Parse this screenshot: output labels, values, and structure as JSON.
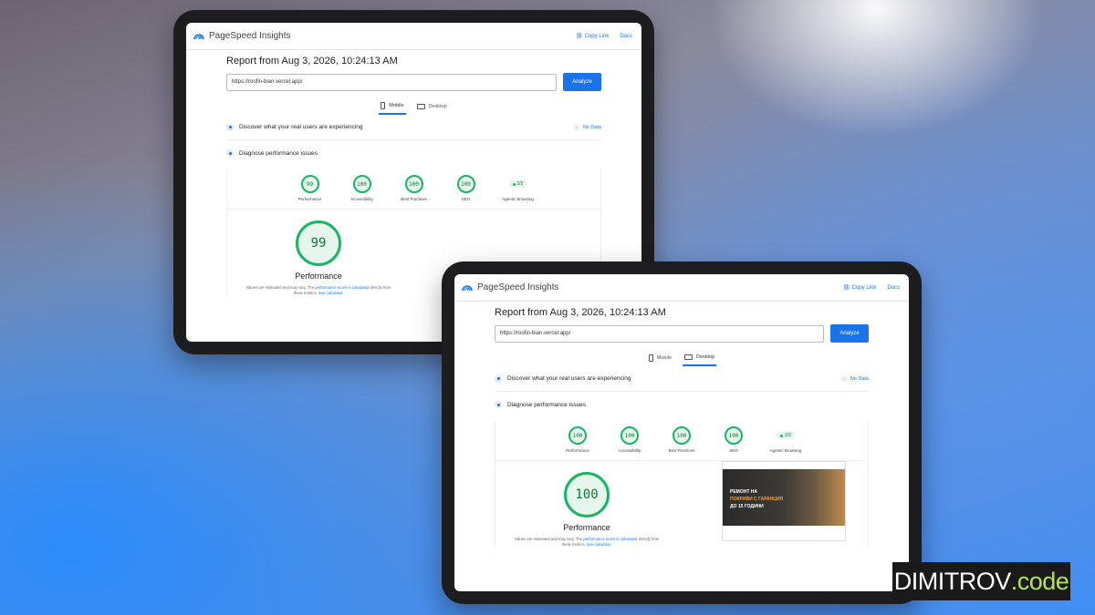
{
  "tablet_mobile": {
    "header": {
      "title": "PageSpeed Insights",
      "copy_link": "Copy Link",
      "docs": "Docs"
    },
    "report_title": "Report from Aug 3, 2026, 10:24:13 AM",
    "url": "https://roofin-bian.vercel.app/",
    "analyze": "Analyze",
    "tabs": {
      "mobile": "Mobile",
      "desktop": "Desktop",
      "active": "Mobile"
    },
    "discover": "Discover what your real users are experiencing",
    "no_data": "No Data",
    "diagnose": "Diagnose performance issues",
    "scores": [
      {
        "value": "99",
        "label": "Performance"
      },
      {
        "value": "100",
        "label": "Accessibility"
      },
      {
        "value": "100",
        "label": "Best Practices"
      },
      {
        "value": "100",
        "label": "SEO"
      }
    ],
    "agentic": {
      "value": "2/2",
      "label": "Agentic Browsing"
    },
    "performance": {
      "score": "99",
      "title": "Performance",
      "note_a": "Values are estimated and may vary. The ",
      "note_link": "performance score is calculated",
      "note_b": "directly from these metrics. ",
      "note_link2": "See calculator."
    }
  },
  "tablet_desktop": {
    "header": {
      "title": "PageSpeed Insights",
      "copy_link": "Copy Link",
      "docs": "Docs"
    },
    "report_title": "Report from Aug 3, 2026, 10:24:13 AM",
    "url": "https://roofin-bian.vercel.app/",
    "analyze": "Analyze",
    "tabs": {
      "mobile": "Mobile",
      "desktop": "Desktop",
      "active": "Desktop"
    },
    "discover": "Discover what your real users are experiencing",
    "no_data": "No Data",
    "diagnose": "Diagnose performance issues",
    "scores": [
      {
        "value": "100",
        "label": "Performance"
      },
      {
        "value": "100",
        "label": "Accessibility"
      },
      {
        "value": "100",
        "label": "Best Practices"
      },
      {
        "value": "100",
        "label": "SEO"
      }
    ],
    "agentic": {
      "value": "2/2",
      "label": "Agentic Browsing"
    },
    "performance": {
      "score": "100",
      "title": "Performance",
      "note_a": "Values are estimated and may vary. The ",
      "note_link": "performance score is calculated",
      "note_b": "directly from these metrics. ",
      "note_link2": "See calculator."
    },
    "screenshot_hero": [
      "РЕМОНТ НА",
      "ПОКРИВИ С ГАРАНЦИЯ",
      "ДО 15 ГОДИНИ"
    ]
  },
  "brand": {
    "part1": "DIMITROV",
    "part2": ".code"
  },
  "colors": {
    "accent": "#1a73e8",
    "pass": "#18b663",
    "brand_green": "#b6e34a"
  }
}
